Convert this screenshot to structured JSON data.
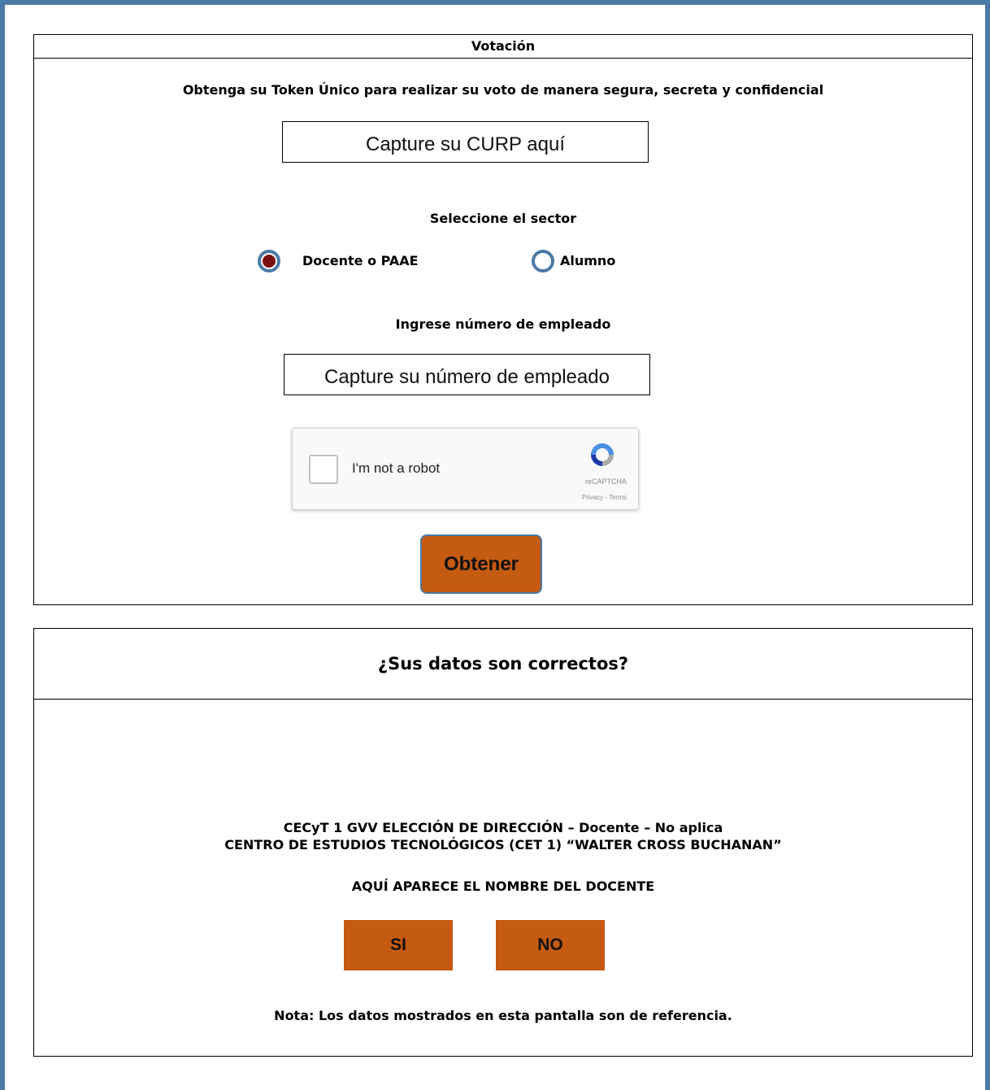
{
  "votacion": {
    "title": "Votación",
    "instruction": "Obtenga su Token Único para realizar su voto de manera segura, secreta y confidencial",
    "curp_placeholder": "Capture su CURP aquí",
    "sector_label": "Seleccione el sector",
    "sector_options": [
      {
        "label": "Docente o PAAE",
        "selected": true
      },
      {
        "label": "Alumno",
        "selected": false
      }
    ],
    "empleado_label": "Ingrese número de empleado",
    "empleado_placeholder": "Capture su número de empleado",
    "captcha": {
      "label": "I'm not a robot",
      "brand": "reCAPTCHA",
      "links": "Privacy - Terms"
    },
    "submit_label": "Obtener"
  },
  "confirm": {
    "title": "¿Sus datos son correctos?",
    "line1": "CECyT 1 GVV ELECCIÓN DE DIRECCIÓN – Docente – No aplica",
    "line2": "CENTRO DE ESTUDIOS TECNOLÓGICOS (CET 1) “WALTER CROSS BUCHANAN”",
    "name_line": "AQUÍ APARECE EL NOMBRE DEL DOCENTE",
    "yes_label": "SI",
    "no_label": "NO",
    "note": "Nota: Los datos mostrados en esta pantalla son de referencia."
  },
  "colors": {
    "frame": "#4a7aa5",
    "button": "#c55a11",
    "radio_selected": "#7c1010"
  }
}
